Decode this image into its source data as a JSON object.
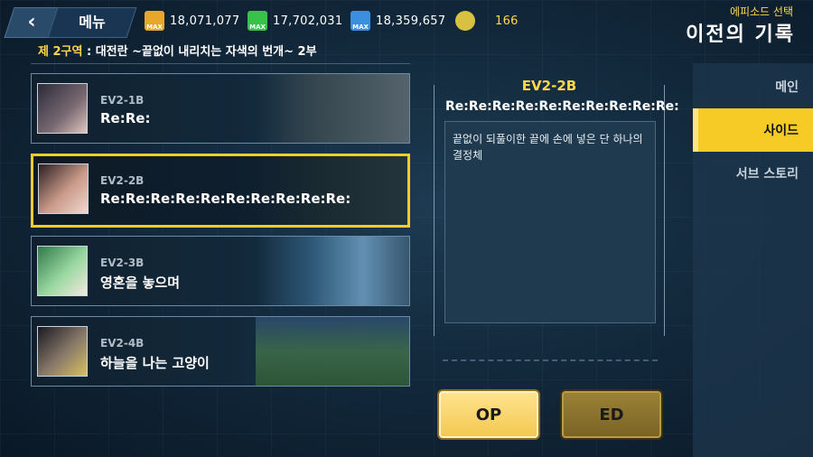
{
  "header": {
    "back_icon": "chevron-left-icon",
    "menu_label": "메뉴",
    "resources": [
      {
        "icon": "gear-max-icon",
        "badge": "MAX",
        "value": "18,071,077",
        "color": "#e8a62a"
      },
      {
        "icon": "recycle-max-icon",
        "badge": "MAX",
        "value": "17,702,031",
        "color": "#38c24a"
      },
      {
        "icon": "lightning-max-icon",
        "badge": "MAX",
        "value": "18,359,657",
        "color": "#3a8fe0"
      },
      {
        "icon": "coin-stack-icon",
        "badge": "",
        "value": "166",
        "color": "#d8c040"
      }
    ],
    "subtitle": "에피소드 선택",
    "title": "이전의 기록"
  },
  "stage": {
    "zone": "제 2구역",
    "separator": " : ",
    "name": "대전란 ~끝없이 내리치는 자색의 번개~ 2부"
  },
  "episodes": [
    {
      "code": "EV2-1B",
      "name": "Re:Re:",
      "selected": false
    },
    {
      "code": "EV2-2B",
      "name": "Re:Re:Re:Re:Re:Re:Re:Re:Re:Re:",
      "selected": true
    },
    {
      "code": "EV2-3B",
      "name": "영혼을 놓으며",
      "selected": false
    },
    {
      "code": "EV2-4B",
      "name": "하늘을 나는 고양이",
      "selected": false
    }
  ],
  "detail": {
    "code": "EV2-2B",
    "title": "Re:Re:Re:Re:Re:Re:Re:Re:Re:Re:",
    "description": "끝없이 되풀이한 끝에 손에 넣은 단 하나의 결정체"
  },
  "buttons": {
    "op_label": "OP",
    "ed_label": "ED"
  },
  "tabs": [
    {
      "label": "메인",
      "active": false
    },
    {
      "label": "사이드",
      "active": true
    },
    {
      "label": "서브 스토리",
      "active": false
    }
  ],
  "colors": {
    "accent": "#f6cb26",
    "highlight_text": "#ffd94a",
    "background": "#112638"
  }
}
